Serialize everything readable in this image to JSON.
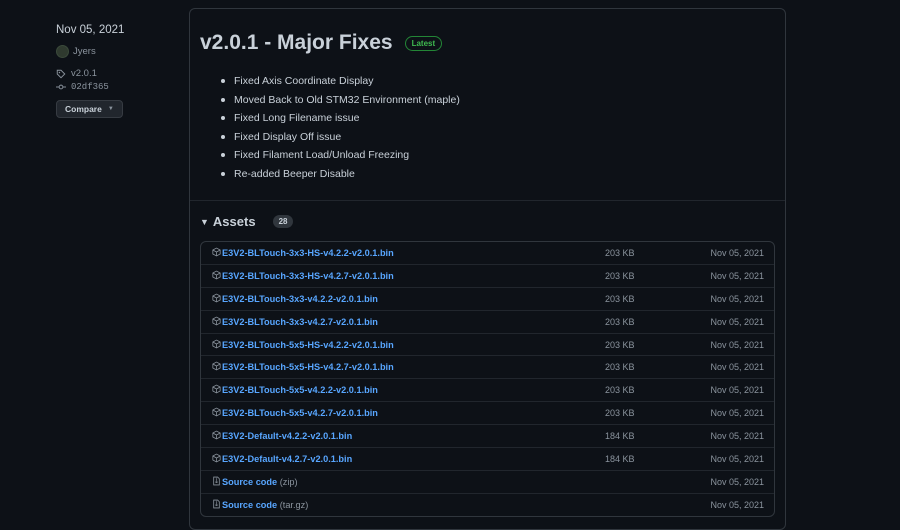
{
  "sidebar": {
    "date": "Nov 05, 2021",
    "author": "Jyers",
    "tag": "v2.0.1",
    "commit": "02df365",
    "compare_label": "Compare",
    "icons": [
      "avatar",
      "tag-icon",
      "commit-icon",
      "triangle-down-icon"
    ]
  },
  "release": {
    "title": "v2.0.1 - Major Fixes",
    "badge": "Latest",
    "notes": [
      "Fixed Axis Coordinate Display",
      "Moved Back to Old STM32 Environment (maple)",
      "Fixed Long Filename issue",
      "Fixed Display Off issue",
      "Fixed Filament Load/Unload Freezing",
      "Re-added Beeper Disable"
    ]
  },
  "assets": {
    "title": "Assets",
    "count": "28",
    "items": [
      {
        "name": "E3V2-BLTouch-3x3-HS-v4.2.2-v2.0.1.bin",
        "suffix": "",
        "size": "203 KB",
        "date": "Nov 05, 2021",
        "icon": "package-icon"
      },
      {
        "name": "E3V2-BLTouch-3x3-HS-v4.2.7-v2.0.1.bin",
        "suffix": "",
        "size": "203 KB",
        "date": "Nov 05, 2021",
        "icon": "package-icon"
      },
      {
        "name": "E3V2-BLTouch-3x3-v4.2.2-v2.0.1.bin",
        "suffix": "",
        "size": "203 KB",
        "date": "Nov 05, 2021",
        "icon": "package-icon"
      },
      {
        "name": "E3V2-BLTouch-3x3-v4.2.7-v2.0.1.bin",
        "suffix": "",
        "size": "203 KB",
        "date": "Nov 05, 2021",
        "icon": "package-icon"
      },
      {
        "name": "E3V2-BLTouch-5x5-HS-v4.2.2-v2.0.1.bin",
        "suffix": "",
        "size": "203 KB",
        "date": "Nov 05, 2021",
        "icon": "package-icon"
      },
      {
        "name": "E3V2-BLTouch-5x5-HS-v4.2.7-v2.0.1.bin",
        "suffix": "",
        "size": "203 KB",
        "date": "Nov 05, 2021",
        "icon": "package-icon"
      },
      {
        "name": "E3V2-BLTouch-5x5-v4.2.2-v2.0.1.bin",
        "suffix": "",
        "size": "203 KB",
        "date": "Nov 05, 2021",
        "icon": "package-icon"
      },
      {
        "name": "E3V2-BLTouch-5x5-v4.2.7-v2.0.1.bin",
        "suffix": "",
        "size": "203 KB",
        "date": "Nov 05, 2021",
        "icon": "package-icon"
      },
      {
        "name": "E3V2-Default-v4.2.2-v2.0.1.bin",
        "suffix": "",
        "size": "184 KB",
        "date": "Nov 05, 2021",
        "icon": "package-icon"
      },
      {
        "name": "E3V2-Default-v4.2.7-v2.0.1.bin",
        "suffix": "",
        "size": "184 KB",
        "date": "Nov 05, 2021",
        "icon": "package-icon"
      },
      {
        "name": "Source code",
        "suffix": " (zip)",
        "size": "",
        "date": "Nov 05, 2021",
        "icon": "file-zip-icon"
      },
      {
        "name": "Source code",
        "suffix": " (tar.gz)",
        "size": "",
        "date": "Nov 05, 2021",
        "icon": "file-zip-icon"
      }
    ]
  },
  "colors": {
    "background": "#0d1117",
    "link": "#58a6ff",
    "badge_green": "#3fb950",
    "muted": "#8b949e",
    "border": "#30363d"
  }
}
